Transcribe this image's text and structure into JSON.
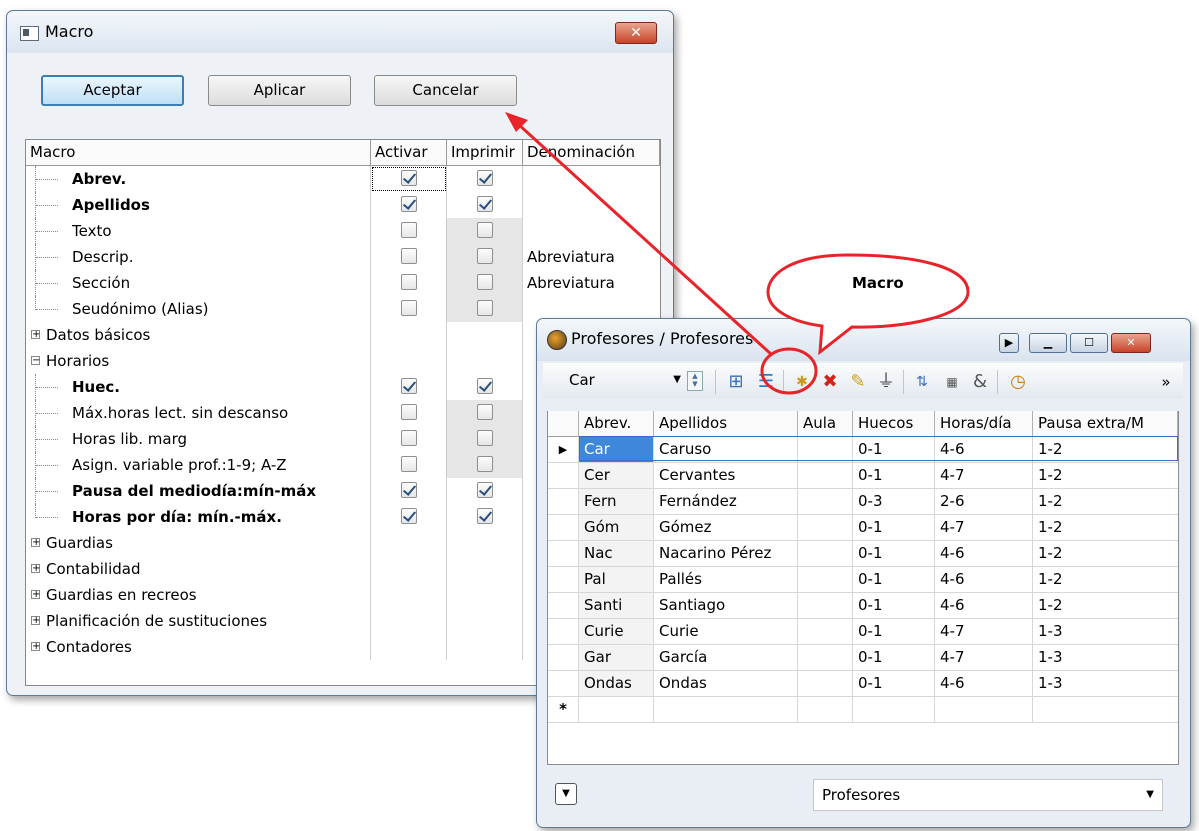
{
  "macro_window": {
    "title": "Macro",
    "close_glyph": "✕",
    "buttons": {
      "accept": "Aceptar",
      "apply": "Aplicar",
      "cancel": "Cancelar"
    },
    "columns": {
      "macro": "Macro",
      "activate": "Activar",
      "print": "Imprimir",
      "denomination": "Denominación"
    },
    "rows": [
      {
        "label": "Abrev.",
        "bold": true,
        "activate": true,
        "print": true,
        "denomination": ""
      },
      {
        "label": "Apellidos",
        "bold": true,
        "activate": true,
        "print": true,
        "denomination": ""
      },
      {
        "label": "Texto",
        "bold": false,
        "activate": false,
        "print": false,
        "denomination": ""
      },
      {
        "label": "Descrip.",
        "bold": false,
        "activate": false,
        "print": false,
        "denomination": "Abreviatura"
      },
      {
        "label": "Sección",
        "bold": false,
        "activate": false,
        "print": false,
        "denomination": "Abreviatura"
      },
      {
        "label": "Seudónimo (Alias)",
        "bold": false,
        "activate": false,
        "print": false,
        "denomination": ""
      },
      {
        "label": "Datos básicos",
        "group": true,
        "expand_glyph": "+"
      },
      {
        "label": "Horarios",
        "group": true,
        "expand_glyph": "−"
      },
      {
        "label": "Huec.",
        "bold": true,
        "activate": true,
        "print": true,
        "denomination": ""
      },
      {
        "label": "Máx.horas lect. sin descanso",
        "bold": false,
        "activate": false,
        "print": false,
        "denomination": ""
      },
      {
        "label": "Horas lib. marg",
        "bold": false,
        "activate": false,
        "print": false,
        "denomination": ""
      },
      {
        "label": "Asign. variable prof.:1-9; A-Z",
        "bold": false,
        "activate": false,
        "print": false,
        "denomination": ""
      },
      {
        "label": "Pausa del mediodía:mín-máx",
        "bold": true,
        "activate": true,
        "print": true,
        "denomination": ""
      },
      {
        "label": "Horas por día: mín.-máx.",
        "bold": true,
        "activate": true,
        "print": true,
        "denomination": ""
      },
      {
        "label": "Guardias",
        "group": true,
        "expand_glyph": "+"
      },
      {
        "label": "Contabilidad",
        "group": true,
        "expand_glyph": "+"
      },
      {
        "label": "Guardias en recreos",
        "group": true,
        "expand_glyph": "+"
      },
      {
        "label": "Planificación de sustituciones",
        "group": true,
        "expand_glyph": "+"
      },
      {
        "label": "Contadores",
        "group": true,
        "expand_glyph": "+"
      }
    ]
  },
  "callout": {
    "text": "Macro",
    "accent": "#e8242a"
  },
  "profesores_window": {
    "title": "Profesores / Profesores",
    "toolbar": {
      "selected": "Car"
    },
    "columns": [
      "Abrev.",
      "Apellidos",
      "Aula",
      "Huecos",
      "Horas/día",
      "Pausa extra/M"
    ],
    "rows": [
      [
        "Car",
        "Caruso",
        "",
        "0-1",
        "4-6",
        "1-2"
      ],
      [
        "Cer",
        "Cervantes",
        "",
        "0-1",
        "4-7",
        "1-2"
      ],
      [
        "Fern",
        "Fernández",
        "",
        "0-3",
        "2-6",
        "1-2"
      ],
      [
        "Góm",
        "Gómez",
        "",
        "0-1",
        "4-7",
        "1-2"
      ],
      [
        "Nac",
        "Nacarino Pérez",
        "",
        "0-1",
        "4-6",
        "1-2"
      ],
      [
        "Pal",
        "Pallés",
        "",
        "0-1",
        "4-6",
        "1-2"
      ],
      [
        "Santi",
        "Santiago",
        "",
        "0-1",
        "4-6",
        "1-2"
      ],
      [
        "Curie",
        "Curie",
        "",
        "0-1",
        "4-7",
        "1-3"
      ],
      [
        "Gar",
        "García",
        "",
        "0-1",
        "4-7",
        "1-3"
      ],
      [
        "Ondas",
        "Ondas",
        "",
        "0-1",
        "4-6",
        "1-3"
      ]
    ],
    "current_row_marker": "▶",
    "new_row_marker": "*",
    "bottom_view": "Profesores",
    "more_glyph": "»"
  }
}
